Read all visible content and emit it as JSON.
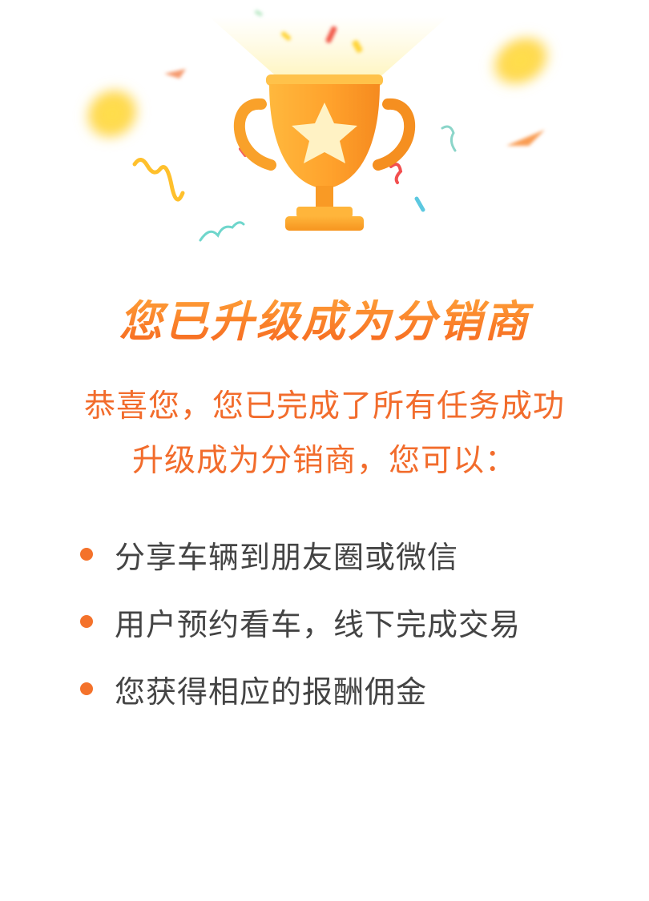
{
  "illustration": {
    "icon": "trophy-icon",
    "decoration": "confetti"
  },
  "headline": "您已升级成为分销商",
  "message": {
    "line1": "恭喜您，您已完成了所有任务成功",
    "line2": "升级成为分销商，您可以："
  },
  "benefits": [
    "分享车辆到朋友圈或微信",
    "用户预约看车，线下完成交易",
    "您获得相应的报酬佣金"
  ],
  "colors": {
    "accent": "#f26c2c",
    "headline_top": "#ffa53a",
    "headline_bottom": "#f5601c",
    "trophy": "#f9a12a",
    "bullet": "#f4722b",
    "body_text": "#444444"
  }
}
